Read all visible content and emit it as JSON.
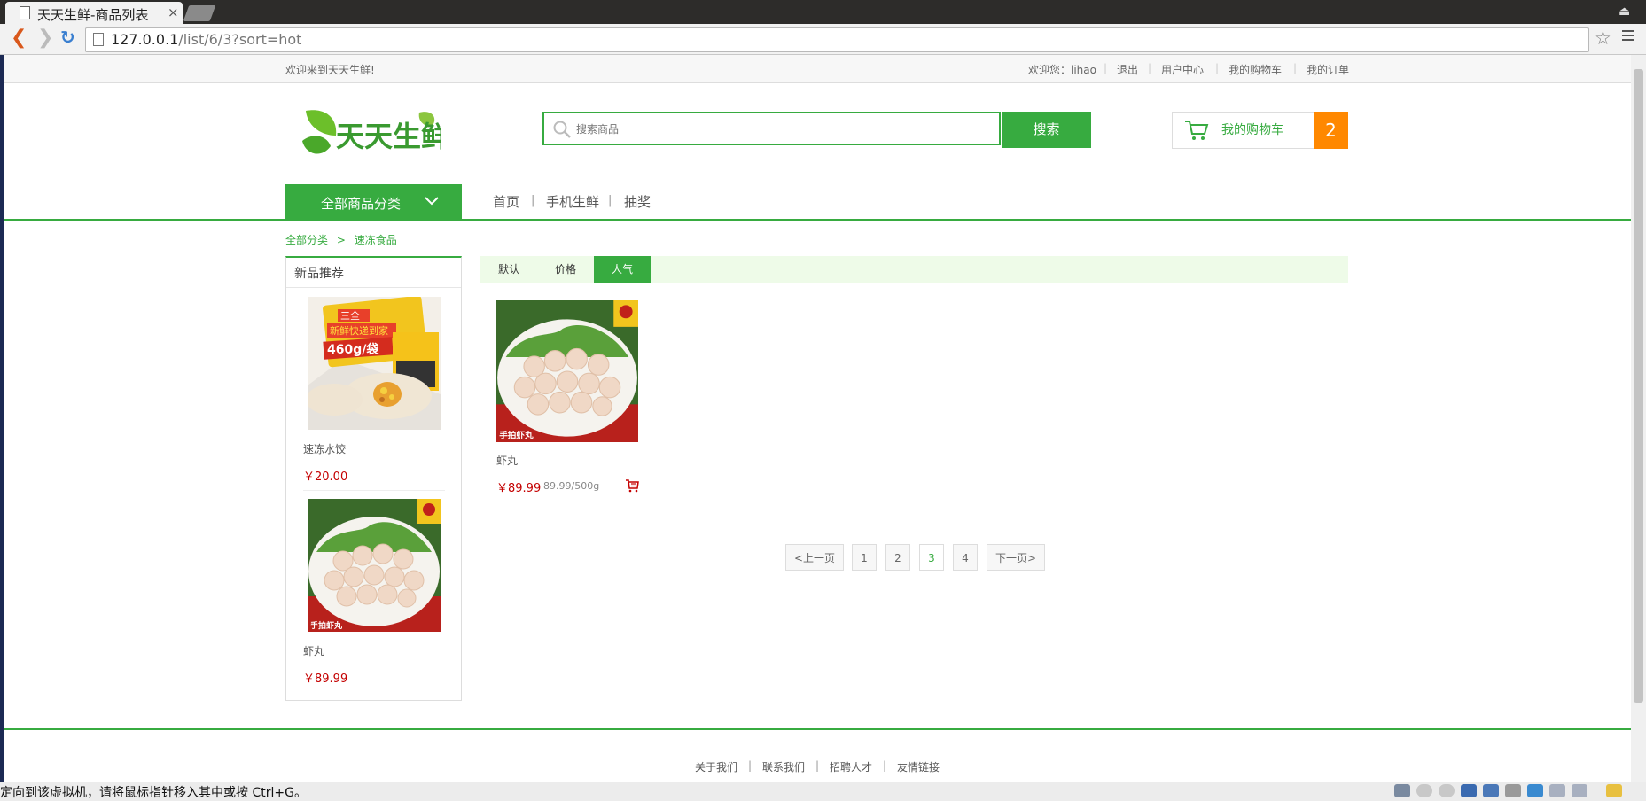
{
  "browser": {
    "tab_title": "天天生鲜-商品列表",
    "tab_close": "×",
    "url_host": "127.0.0.1",
    "url_path": "/list/6/3?sort=hot",
    "menu_glyph": "⏏"
  },
  "header": {
    "welcome": "欢迎来到天天生鲜!",
    "user_greeting": "欢迎您：lihao",
    "links": [
      "退出",
      "用户中心",
      "我的购物车",
      "我的订单"
    ],
    "separator": "|"
  },
  "logo": {
    "text": "天天生鲜"
  },
  "search": {
    "placeholder": "搜索商品",
    "button": "搜索"
  },
  "cart": {
    "label": "我的购物车",
    "count": "2"
  },
  "nav": {
    "all_categories": "全部商品分类",
    "links": [
      "首页",
      "手机生鲜",
      "抽奖"
    ]
  },
  "breadcrumb": {
    "root": "全部分类",
    "sep": ">",
    "current": "速冻食品"
  },
  "sidebar": {
    "title": "新品推荐",
    "items": [
      {
        "name": "速冻水饺",
        "price": "￥20.00",
        "img_text": {
          "a": "三全",
          "b": "新鲜快递到家",
          "c": "460g/袋"
        }
      },
      {
        "name": "虾丸",
        "price": "￥89.99",
        "img_text": "手拍虾丸"
      }
    ]
  },
  "sort": {
    "options": [
      "默认",
      "价格",
      "人气"
    ],
    "active": "人气"
  },
  "products": [
    {
      "name": "虾丸",
      "price": "￥89.99",
      "unit": "89.99/500g",
      "img_text": "手拍虾丸"
    }
  ],
  "pagination": {
    "prev": "<上一页",
    "pages": [
      "1",
      "2",
      "3",
      "4"
    ],
    "current": "3",
    "next": "下一页>"
  },
  "footer": {
    "links": [
      "关于我们",
      "联系我们",
      "招聘人才",
      "友情链接"
    ],
    "separator": "|"
  },
  "vm_status": {
    "text": "定向到该虚拟机，请将鼠标指针移入其中或按 Ctrl+G。"
  },
  "colors": {
    "brand_green": "#37ab40",
    "cart_orange": "#ff8800",
    "price_red": "#c40000",
    "sort_bar_bg": "#eefbe8"
  }
}
